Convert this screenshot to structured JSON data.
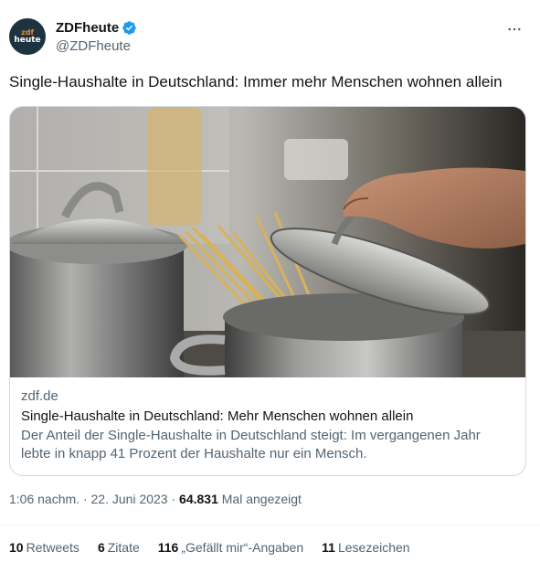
{
  "account": {
    "avatar_line1": "zdf",
    "avatar_line2": "heute",
    "display_name": "ZDFheute",
    "handle": "@ZDFheute",
    "verified": true
  },
  "menu": {
    "more_icon": "more-horizontal-icon"
  },
  "tweet": {
    "text": "Single-Haushalte in Deutschland: Immer mehr Menschen wohnen allein"
  },
  "card": {
    "domain": "zdf.de",
    "title": "Single-Haushalte in Deutschland: Mehr Menschen wohnen allein",
    "description": "Der Anteil der Single-Haushalte in Deutschland steigt: Im vergangenen Jahr lebte in knapp 41 Prozent der Haushalte nur ein Mensch."
  },
  "meta": {
    "time": "1:06 nachm.",
    "sep1": " · ",
    "date": "22. Juni 2023",
    "sep2": " · ",
    "views": "64.831",
    "views_label": "Mal angezeigt"
  },
  "stats": [
    {
      "count": "10",
      "label": "Retweets"
    },
    {
      "count": "6",
      "label": "Zitate"
    },
    {
      "count": "116",
      "label": "„Gefällt mir“-Angaben"
    },
    {
      "count": "11",
      "label": "Lesezeichen"
    }
  ],
  "colors": {
    "verified_blue": "#1d9bf0",
    "secondary_text": "#536471",
    "primary_text": "#0f1419",
    "border": "#cfd9de",
    "avatar_bg": "#1d3340",
    "avatar_accent": "#f08a24"
  }
}
